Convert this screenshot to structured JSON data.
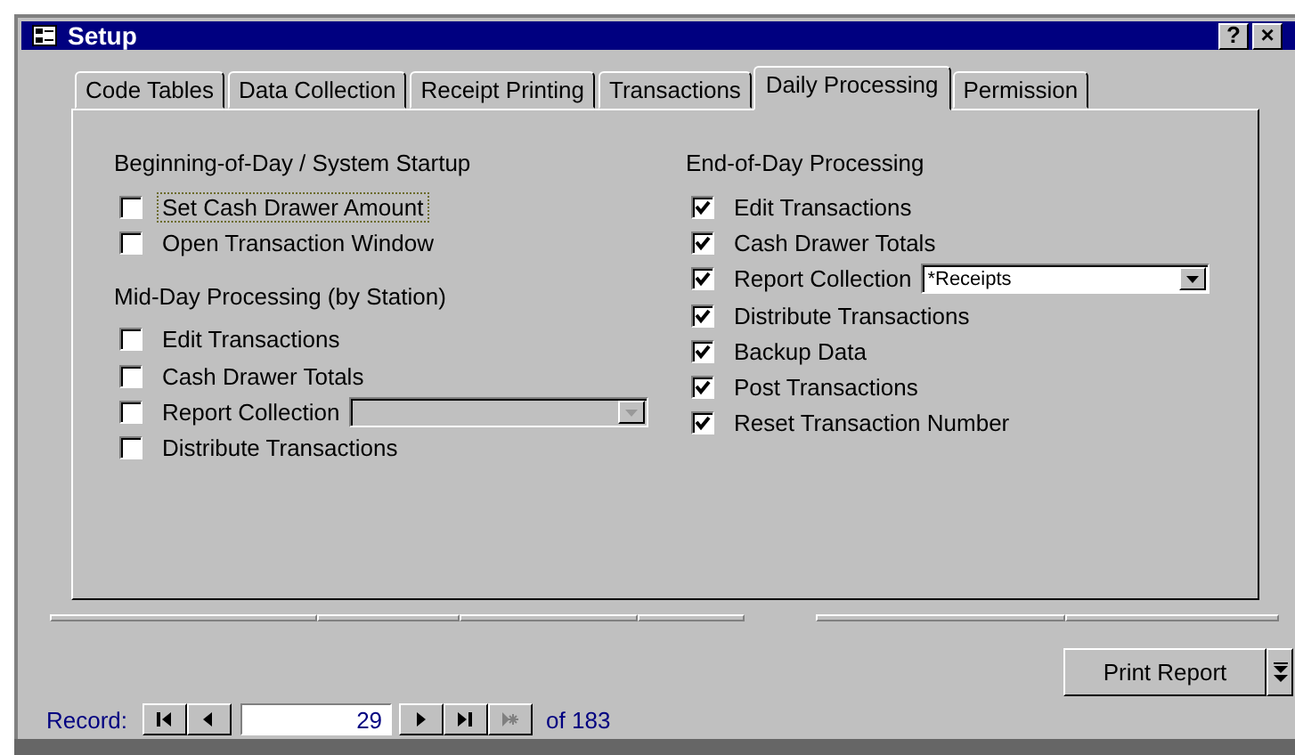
{
  "window": {
    "title": "Setup",
    "help_button": "?",
    "close_button": "×"
  },
  "tabs": [
    {
      "label": "Code Tables",
      "selected": false
    },
    {
      "label": "Data Collection",
      "selected": false
    },
    {
      "label": "Receipt Printing",
      "selected": false
    },
    {
      "label": "Transactions",
      "selected": false
    },
    {
      "label": "Daily Processing",
      "selected": true
    },
    {
      "label": "Permission",
      "selected": false
    }
  ],
  "columns": [
    {
      "groups": [
        {
          "heading": "Beginning-of-Day / System Startup",
          "items": [
            {
              "kind": "checkbox",
              "label": "Set Cash Drawer Amount",
              "checked": false,
              "focused": true
            },
            {
              "kind": "checkbox",
              "label": "Open Transaction Window",
              "checked": false,
              "focused": false
            }
          ]
        },
        {
          "heading": "Mid-Day Processing (by Station)",
          "items": [
            {
              "kind": "checkbox",
              "label": "Edit Transactions",
              "checked": false,
              "focused": false
            },
            {
              "kind": "checkbox",
              "label": "Cash Drawer Totals",
              "checked": false,
              "focused": false
            },
            {
              "kind": "checkbox-combo",
              "label": "Report Collection",
              "checked": false,
              "focused": false,
              "combo": {
                "disabled": true
              }
            },
            {
              "kind": "checkbox",
              "label": "Distribute Transactions",
              "checked": false,
              "focused": false
            }
          ]
        }
      ]
    },
    {
      "groups": [
        {
          "heading": "End-of-Day Processing",
          "items": [
            {
              "kind": "checkbox",
              "label": "Edit Transactions",
              "checked": true,
              "focused": false
            },
            {
              "kind": "checkbox",
              "label": "Cash Drawer Totals",
              "checked": true,
              "focused": false
            },
            {
              "kind": "checkbox-combo",
              "label": "Report Collection",
              "checked": true,
              "focused": false,
              "combo": {
                "value": "*Receipts",
                "disabled": false
              }
            },
            {
              "kind": "checkbox",
              "label": "Distribute Transactions",
              "checked": true,
              "focused": false
            },
            {
              "kind": "checkbox",
              "label": "Backup Data",
              "checked": true,
              "focused": false
            },
            {
              "kind": "checkbox",
              "label": "Post Transactions",
              "checked": true,
              "focused": false
            },
            {
              "kind": "checkbox",
              "label": "Reset Transaction Number",
              "checked": true,
              "focused": false
            }
          ]
        }
      ]
    }
  ],
  "print_button": "Print Report",
  "record_nav": {
    "label": "Record:",
    "value": "29",
    "total": "of 183",
    "buttons": [
      {
        "kind": "first",
        "disabled": false
      },
      {
        "kind": "prev",
        "disabled": false
      },
      {
        "kind": "next",
        "disabled": false
      },
      {
        "kind": "last",
        "disabled": false
      },
      {
        "kind": "new",
        "disabled": true
      }
    ]
  }
}
